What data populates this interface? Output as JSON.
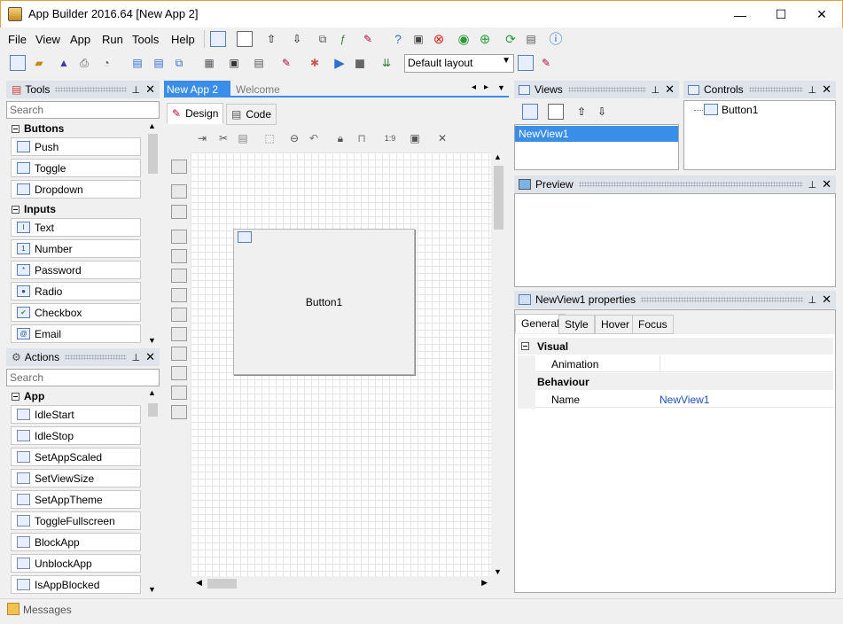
{
  "window": {
    "title": "App Builder 2016.64 [New App 2]",
    "minimize": "—",
    "maximize": "☐",
    "close": "✕"
  },
  "menu": [
    "File",
    "View",
    "App",
    "Run",
    "Tools",
    "Help"
  ],
  "toolbar": {
    "layout_value": "Default layout"
  },
  "tools_panel": {
    "title": "Tools",
    "search_placeholder": "Search",
    "groups": [
      {
        "name": "Buttons",
        "items": [
          "Push",
          "Toggle",
          "Dropdown"
        ]
      },
      {
        "name": "Inputs",
        "items": [
          "Text",
          "Number",
          "Password",
          "Radio",
          "Checkbox",
          "Email"
        ]
      }
    ]
  },
  "actions_panel": {
    "title": "Actions",
    "search_placeholder": "Search",
    "group": "App",
    "items": [
      "IdleStart",
      "IdleStop",
      "SetAppScaled",
      "SetViewSize",
      "SetAppTheme",
      "ToggleFullscreen",
      "BlockApp",
      "UnblockApp",
      "IsAppBlocked"
    ]
  },
  "documents": {
    "tabs": [
      {
        "label": "New App 2",
        "close": "✕"
      },
      {
        "label": "Welcome"
      }
    ],
    "subtabs": [
      "Design",
      "Code"
    ],
    "canvas_button": "Button1"
  },
  "views_panel": {
    "title": "Views",
    "items": [
      "NewView1"
    ]
  },
  "controls_panel": {
    "title": "Controls",
    "items": [
      "Button1"
    ]
  },
  "preview_panel": {
    "title": "Preview"
  },
  "properties_panel": {
    "title": "NewView1 properties",
    "tabs": [
      "General",
      "Style",
      "Hover",
      "Focus"
    ],
    "sections": [
      {
        "name": "Visual",
        "rows": [
          {
            "key": "Animation",
            "value": ""
          }
        ]
      },
      {
        "name": "Behaviour",
        "rows": [
          {
            "key": "Name",
            "value": "NewView1"
          }
        ]
      }
    ]
  },
  "status": {
    "messages": "Messages"
  },
  "colors": {
    "accent": "#3b8ee8",
    "panel_header": "#dfe3ea",
    "window_border": "#e8a03a"
  }
}
